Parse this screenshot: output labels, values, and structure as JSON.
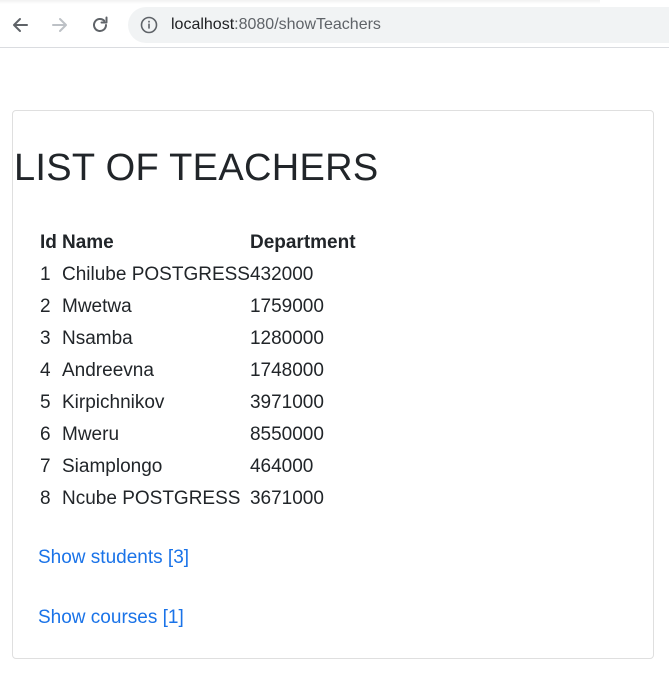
{
  "browser": {
    "url_host": "localhost",
    "url_rest": ":8080/showTeachers"
  },
  "page": {
    "title": "LIST OF TEACHERS"
  },
  "table": {
    "headers": {
      "id": "Id",
      "name": "Name",
      "department": "Department"
    },
    "rows": [
      {
        "id": "1",
        "name": "Chilube POSTGRESS",
        "department": "432000"
      },
      {
        "id": "2",
        "name": "Mwetwa",
        "department": "1759000"
      },
      {
        "id": "3",
        "name": "Nsamba",
        "department": "1280000"
      },
      {
        "id": "4",
        "name": "Andreevna",
        "department": "1748000"
      },
      {
        "id": "5",
        "name": "Kirpichnikov",
        "department": "3971000"
      },
      {
        "id": "6",
        "name": "Mweru",
        "department": "8550000"
      },
      {
        "id": "7",
        "name": "Siamplongo",
        "department": "464000"
      },
      {
        "id": "8",
        "name": "Ncube POSTGRESS",
        "department": "3671000"
      }
    ]
  },
  "links": {
    "students": "Show students [3]",
    "courses": "Show courses [1]"
  },
  "colors": {
    "link": "#1a73e8",
    "text": "#212529",
    "omnibox": "#f1f3f4"
  },
  "icons": {
    "back": "arrow-left-icon",
    "forward": "arrow-right-icon",
    "reload": "reload-icon",
    "info": "info-icon"
  }
}
